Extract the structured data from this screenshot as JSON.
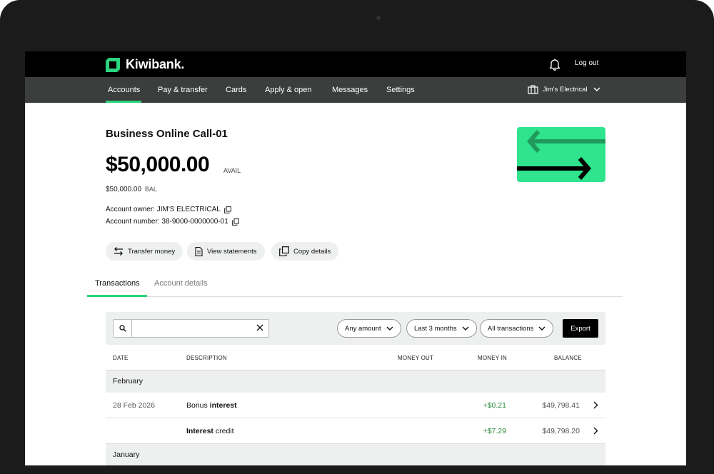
{
  "app": {
    "brand": "Kiwibank.",
    "logout_label": "Log out",
    "accent_color": "#2bd47d",
    "card_color": "#2fe48c"
  },
  "nav": {
    "items": [
      {
        "label": "Accounts",
        "active": true
      },
      {
        "label": "Pay & transfer"
      },
      {
        "label": "Cards"
      },
      {
        "label": "Apply & open"
      },
      {
        "label": "Messages"
      },
      {
        "label": "Settings"
      }
    ],
    "business_name": "Jim's Electrical"
  },
  "account": {
    "name": "Business Online Call-01",
    "available": "$50,000.00",
    "available_suffix": "AVAIL",
    "balance": "$50,000.00",
    "balance_suffix": "BAL",
    "owner_label": "Account owner:",
    "owner": "JIM'S ELECTRICAL",
    "number_label": "Account number:",
    "number": "38-9000-0000000-01"
  },
  "actions": {
    "transfer": "Transfer money",
    "statements": "View statements",
    "copy": "Copy details"
  },
  "tabs": {
    "transactions": "Transactions",
    "details": "Account details"
  },
  "filters": {
    "search_value": "",
    "amount": "Any amount",
    "period": "Last 3 months",
    "type": "All transactions",
    "export": "Export"
  },
  "table": {
    "headers": {
      "date": "DATE",
      "description": "DESCRIPTION",
      "money_out": "MONEY OUT",
      "money_in": "MONEY IN",
      "balance": "BALANCE"
    },
    "groups": [
      {
        "month": "February",
        "rows": [
          {
            "date": "28 Feb 2026",
            "desc_a": "Bonus",
            "desc_b": "interest",
            "money_in": "+$0.21",
            "balance": "$49,798.41"
          },
          {
            "date": "",
            "desc_a": "Interest",
            "desc_b": "credit",
            "money_in": "+$7.29",
            "balance": "$49,798.20"
          }
        ]
      },
      {
        "month": "January",
        "rows": []
      }
    ]
  }
}
